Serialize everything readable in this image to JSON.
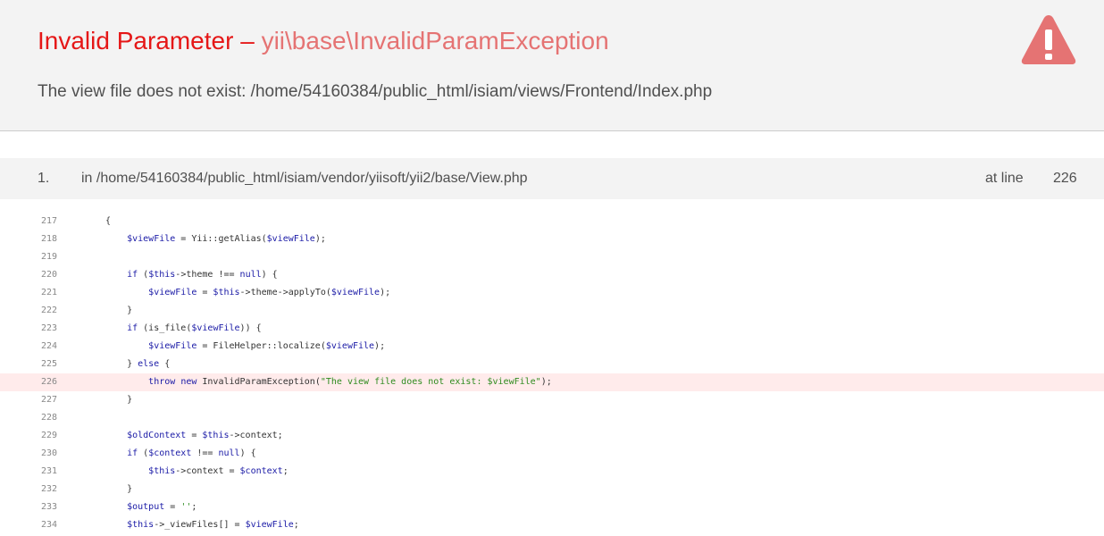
{
  "error": {
    "name": "Invalid Parameter",
    "separator": " – ",
    "class": "yii\\base\\InvalidParamException",
    "message": "The view file does not exist: /home/54160384/public_html/isiam/views/Frontend/Index.php"
  },
  "call_stack": [
    {
      "number": "1.",
      "file": "in /home/54160384/public_html/isiam/vendor/yiisoft/yii2/base/View.php",
      "at_label": "at line",
      "line": "226"
    }
  ],
  "code_lines": [
    {
      "n": "217",
      "t": "{"
    },
    {
      "n": "218",
      "t": "    $viewFile = Yii::getAlias($viewFile);"
    },
    {
      "n": "219",
      "t": ""
    },
    {
      "n": "220",
      "t": "    if ($this->theme !== null) {"
    },
    {
      "n": "221",
      "t": "        $viewFile = $this->theme->applyTo($viewFile);"
    },
    {
      "n": "222",
      "t": "    }"
    },
    {
      "n": "223",
      "t": "    if (is_file($viewFile)) {"
    },
    {
      "n": "224",
      "t": "        $viewFile = FileHelper::localize($viewFile);"
    },
    {
      "n": "225",
      "t": "    } else {"
    },
    {
      "n": "226",
      "t": "        throw new InvalidParamException(\"The view file does not exist: $viewFile\");",
      "error": true
    },
    {
      "n": "227",
      "t": "    }"
    },
    {
      "n": "228",
      "t": ""
    },
    {
      "n": "229",
      "t": "    $oldContext = $this->context;"
    },
    {
      "n": "230",
      "t": "    if ($context !== null) {"
    },
    {
      "n": "231",
      "t": "        $this->context = $context;"
    },
    {
      "n": "232",
      "t": "    }"
    },
    {
      "n": "233",
      "t": "    $output = '';"
    },
    {
      "n": "234",
      "t": "    $this->_viewFiles[] = $viewFile;"
    }
  ],
  "colors": {
    "title": "#e51717",
    "icon": "#e57373",
    "highlight_row": "#ffebeb"
  },
  "icons": {
    "warning": "warning-triangle-icon"
  }
}
